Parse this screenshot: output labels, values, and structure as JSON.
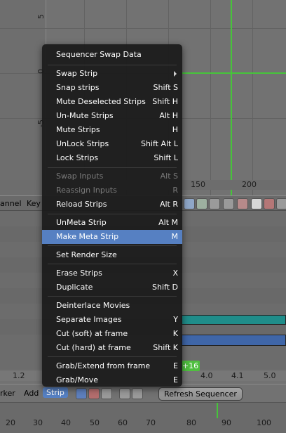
{
  "preview": {
    "left_ticks": [
      "5",
      "0",
      "-5"
    ],
    "ruler_ticks": [
      "150",
      "200"
    ]
  },
  "header_upper": {
    "channel_label": "annel",
    "key_label": "Key"
  },
  "time_ruler": {
    "labels": [
      "1.2",
      "4.0",
      "4.1",
      "5.0"
    ]
  },
  "frame_badge": "+16",
  "header_lower": {
    "marker": "rker",
    "add": "Add",
    "strip": "Strip",
    "refresh": "Refresh Sequencer"
  },
  "footer": {
    "labels": [
      "20",
      "30",
      "40",
      "50",
      "60",
      "70",
      "80",
      "90",
      "100"
    ]
  },
  "menu": {
    "title": "Sequencer Swap Data",
    "items": [
      {
        "label": "Swap Strip",
        "shortcut": "",
        "submenu": true
      },
      {
        "label": "Snap strips",
        "shortcut": "Shift S"
      },
      {
        "label": "Mute Deselected Strips",
        "shortcut": "Shift H"
      },
      {
        "label": "Un-Mute Strips",
        "shortcut": "Alt H"
      },
      {
        "label": "Mute Strips",
        "shortcut": "H"
      },
      {
        "label": "UnLock Strips",
        "shortcut": "Shift Alt L"
      },
      {
        "label": "Lock Strips",
        "shortcut": "Shift L"
      },
      {
        "label": "Swap Inputs",
        "shortcut": "Alt S",
        "disabled": true
      },
      {
        "label": "Reassign Inputs",
        "shortcut": "R",
        "disabled": true
      },
      {
        "label": "Reload Strips",
        "shortcut": "Alt R"
      },
      {
        "label": "UnMeta Strip",
        "shortcut": "Alt M"
      },
      {
        "label": "Make Meta Strip",
        "shortcut": "M",
        "highlight": true
      },
      {
        "label": "Set Render Size",
        "shortcut": ""
      },
      {
        "label": "Erase Strips",
        "shortcut": "X"
      },
      {
        "label": "Duplicate",
        "shortcut": "Shift D"
      },
      {
        "label": "Deinterlace Movies",
        "shortcut": ""
      },
      {
        "label": "Separate Images",
        "shortcut": "Y"
      },
      {
        "label": "Cut (soft) at frame",
        "shortcut": "K"
      },
      {
        "label": "Cut (hard) at frame",
        "shortcut": "Shift K"
      },
      {
        "label": "Grab/Extend from frame",
        "shortcut": "E"
      },
      {
        "label": "Grab/Move",
        "shortcut": "E"
      }
    ]
  }
}
